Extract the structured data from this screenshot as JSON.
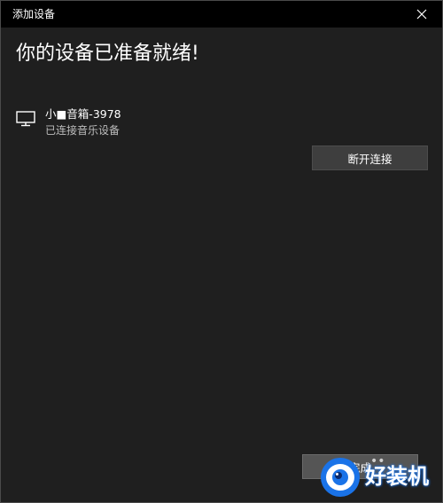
{
  "window": {
    "title": "添加设备"
  },
  "main": {
    "heading": "你的设备已准备就绪!",
    "device": {
      "icon": "monitor-icon",
      "name": "小■音箱-3978",
      "status": "已连接音乐设备"
    },
    "disconnect_label": "断开连接",
    "done_label": "完成"
  },
  "watermark": {
    "text": "好装机",
    "icon": "logo-icon"
  },
  "colors": {
    "titlebar": "#000000",
    "background": "#1f1f1f",
    "button": "#3e3e3e",
    "watermark_accent": "#1a73e8"
  }
}
